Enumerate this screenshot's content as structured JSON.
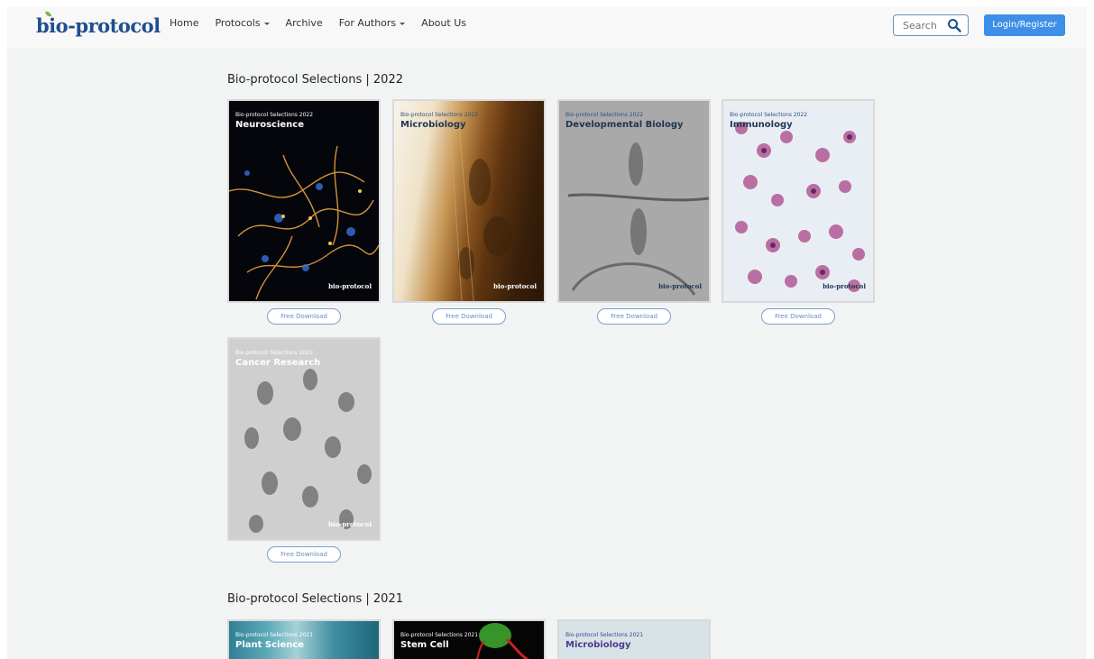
{
  "header": {
    "logo": "bio-protocol",
    "nav": [
      {
        "label": "Home",
        "has_caret": false
      },
      {
        "label": "Protocols",
        "has_caret": true
      },
      {
        "label": "Archive",
        "has_caret": false
      },
      {
        "label": "For Authors",
        "has_caret": true
      },
      {
        "label": "About Us",
        "has_caret": false
      }
    ],
    "search_placeholder": "Search",
    "login_label": "Login/Register"
  },
  "sections": [
    {
      "title": "Bio-protocol Selections | 2022",
      "covers": [
        {
          "series": "Bio-protocol Selections 2022",
          "topic": "Neuroscience",
          "button": "Free Download"
        },
        {
          "series": "Bio-protocol Selections 2022",
          "topic": "Microbiology",
          "button": "Free Download"
        },
        {
          "series": "Bio-protocol Selections 2022",
          "topic": "Developmental Biology",
          "button": "Free Download"
        },
        {
          "series": "Bio-protocol Selections 2022",
          "topic": "Immunology",
          "button": "Free Download"
        },
        {
          "series": "Bio-protocol Selections 2022",
          "topic": "Cancer Research",
          "button": "Free Download"
        }
      ]
    },
    {
      "title": "Bio-protocol Selections | 2021",
      "covers": [
        {
          "series": "Bio-protocol Selections 2021",
          "topic": "Plant Science"
        },
        {
          "series": "Bio-protocol Selections 2021",
          "topic": "Stem Cell"
        },
        {
          "series": "Bio-protocol Selections 2021",
          "topic": "Microbiology"
        }
      ]
    }
  ],
  "cover_brand": "bio-protocol",
  "colors": {
    "brand_blue": "#1e4f8e",
    "button_blue": "#3d8fe8",
    "outline_blue": "#7a9ed0"
  }
}
